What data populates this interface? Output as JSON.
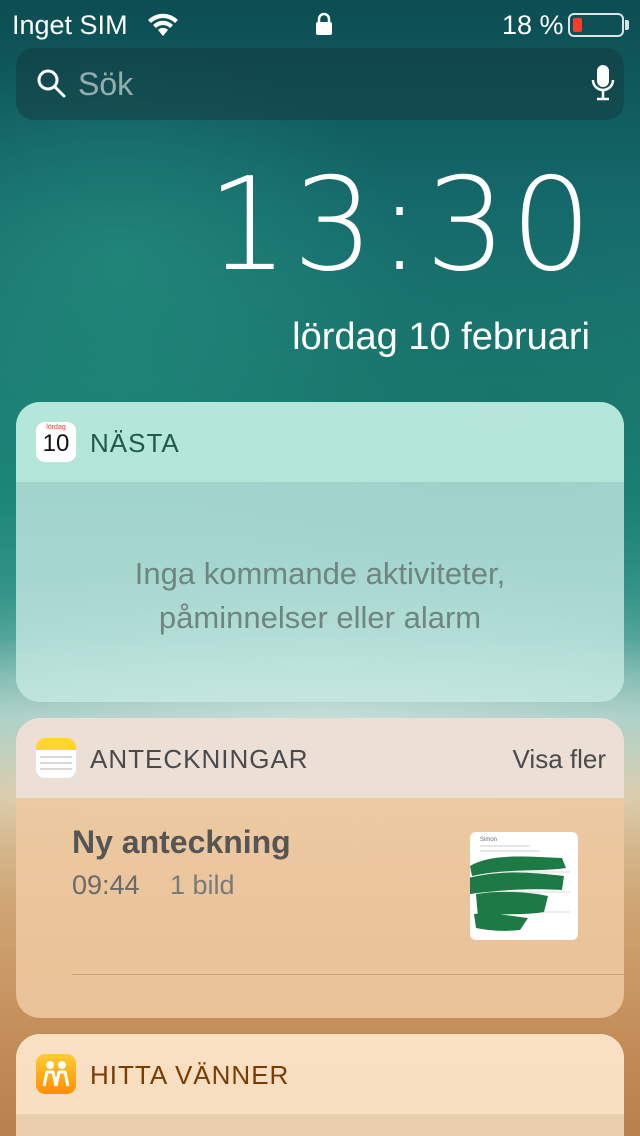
{
  "status_bar": {
    "carrier": "Inget SIM",
    "battery_percent_label": "18 %",
    "battery_level": 0.18,
    "battery_color": "#ff3b30",
    "icons": [
      "wifi-icon",
      "lock-icon",
      "battery-icon"
    ]
  },
  "search": {
    "placeholder": "Sök",
    "icons": [
      "search-icon",
      "microphone-icon"
    ]
  },
  "lockscreen": {
    "time": "13:30",
    "date": "lördag 10 februari"
  },
  "widgets": {
    "calendar": {
      "title": "NÄSTA",
      "icon_day": "lördag",
      "icon_date": "10",
      "empty_message_line1": "Inga kommande aktiviteter,",
      "empty_message_line2": "påminnelser eller alarm"
    },
    "notes": {
      "title": "ANTECKNINGAR",
      "more_label": "Visa fler",
      "note": {
        "title": "Ny anteckning",
        "time": "09:44",
        "meta": "1 bild",
        "thumbnail_header": "Simon"
      }
    },
    "find_friends": {
      "title": "HITTA VÄNNER"
    }
  },
  "colors": {
    "calendar_title": "#1f5a4a",
    "find_friends_title": "#7a3c00",
    "notes_icon_yellow": "#ffd52e",
    "redaction_green": "#1e7a45"
  }
}
